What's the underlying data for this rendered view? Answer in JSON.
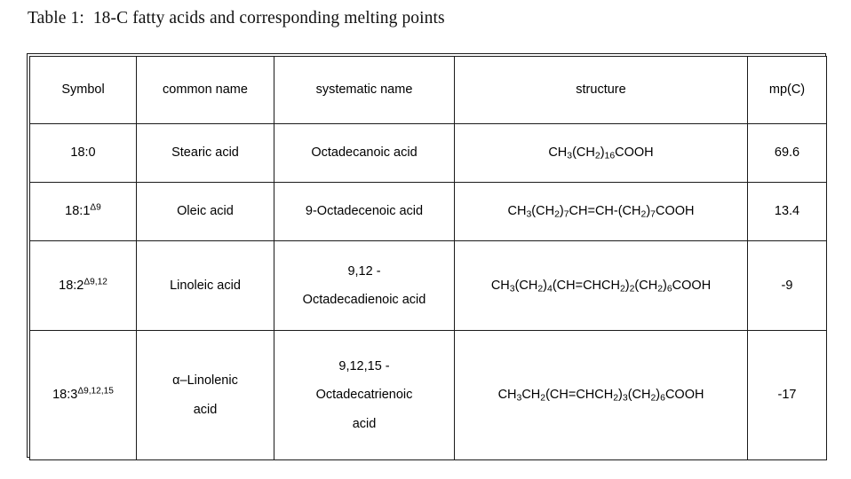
{
  "caption": "Table 1:  18-C fatty acids and corresponding melting points",
  "table": {
    "headers": {
      "symbol": "Symbol",
      "common_name": "common name",
      "systematic_name": "systematic name",
      "structure": "structure",
      "mp": "mp(C)"
    },
    "rows": [
      {
        "symbol_base": "18:0",
        "symbol_sup": "",
        "common_name": "Stearic acid",
        "systematic_name_lines": [
          "Octadecanoic acid"
        ],
        "structure_parts": [
          {
            "t": "CH",
            "sub": false
          },
          {
            "t": "3",
            "sub": true
          },
          {
            "t": "(CH",
            "sub": false
          },
          {
            "t": "2",
            "sub": true
          },
          {
            "t": ")",
            "sub": false
          },
          {
            "t": "16",
            "sub": true
          },
          {
            "t": "COOH",
            "sub": false
          }
        ],
        "structure_text": "CH3(CH2)16COOH",
        "mp": "69.6"
      },
      {
        "symbol_base": "18:1",
        "symbol_sup": "Δ9",
        "common_name": "Oleic acid",
        "systematic_name_lines": [
          "9-Octadecenoic acid"
        ],
        "structure_parts": [
          {
            "t": "CH",
            "sub": false
          },
          {
            "t": "3",
            "sub": true
          },
          {
            "t": "(CH",
            "sub": false
          },
          {
            "t": "2",
            "sub": true
          },
          {
            "t": ")",
            "sub": false
          },
          {
            "t": "7",
            "sub": true
          },
          {
            "t": "CH=CH-(CH",
            "sub": false
          },
          {
            "t": "2",
            "sub": true
          },
          {
            "t": ")",
            "sub": false
          },
          {
            "t": "7",
            "sub": true
          },
          {
            "t": "COOH",
            "sub": false
          }
        ],
        "structure_text": "CH3(CH2)7CH=CH-(CH2)7COOH",
        "mp": "13.4"
      },
      {
        "symbol_base": "18:2",
        "symbol_sup": "Δ9,12",
        "common_name": "Linoleic acid",
        "systematic_name_lines": [
          "9,12 -",
          "Octadecadienoic acid"
        ],
        "structure_parts": [
          {
            "t": "CH",
            "sub": false
          },
          {
            "t": "3",
            "sub": true
          },
          {
            "t": "(CH",
            "sub": false
          },
          {
            "t": "2",
            "sub": true
          },
          {
            "t": ")",
            "sub": false
          },
          {
            "t": "4",
            "sub": true
          },
          {
            "t": "(CH=CHCH",
            "sub": false
          },
          {
            "t": "2",
            "sub": true
          },
          {
            "t": ")",
            "sub": false
          },
          {
            "t": "2",
            "sub": true
          },
          {
            "t": "(CH",
            "sub": false
          },
          {
            "t": "2",
            "sub": true
          },
          {
            "t": ")",
            "sub": false
          },
          {
            "t": "6",
            "sub": true
          },
          {
            "t": "COOH",
            "sub": false
          }
        ],
        "structure_text": "CH3(CH2)4(CH=CHCH2)2(CH2)6COOH",
        "mp": "-9"
      },
      {
        "symbol_base": "18:3",
        "symbol_sup": "Δ9,12,15",
        "common_name_lines": [
          "α–Linolenic",
          "acid"
        ],
        "common_name": "α–Linolenic acid",
        "systematic_name_lines": [
          "9,12,15 -",
          "Octadecatrienoic",
          "acid"
        ],
        "structure_parts": [
          {
            "t": "CH",
            "sub": false
          },
          {
            "t": "3",
            "sub": true
          },
          {
            "t": "CH",
            "sub": false
          },
          {
            "t": "2",
            "sub": true
          },
          {
            "t": "(CH=CHCH",
            "sub": false
          },
          {
            "t": "2",
            "sub": true
          },
          {
            "t": ")",
            "sub": false
          },
          {
            "t": "3",
            "sub": true
          },
          {
            "t": "(CH",
            "sub": false
          },
          {
            "t": "2",
            "sub": true
          },
          {
            "t": ")",
            "sub": false
          },
          {
            "t": "6",
            "sub": true
          },
          {
            "t": "COOH",
            "sub": false
          }
        ],
        "structure_text": "CH3CH2(CH=CHCH2)3(CH2)6COOH",
        "mp": "-17"
      }
    ]
  },
  "colors": {
    "border": "#1a1a1a",
    "text": "#000000",
    "background": "#ffffff"
  }
}
